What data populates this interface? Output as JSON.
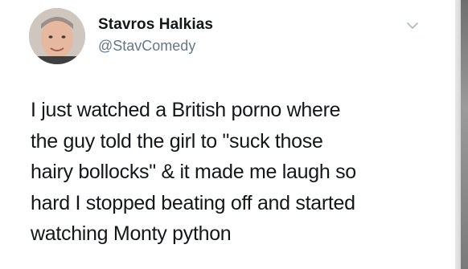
{
  "tweet": {
    "display_name": "Stavros Halkias",
    "handle": "@StavComedy",
    "text_lines": [
      "I just watched a British porno where",
      "the guy told the girl to \"suck those",
      "hairy bollocks\" & it made me laugh so",
      "hard I stopped beating off and started",
      "watching Monty python"
    ]
  },
  "icons": {
    "avatar": "profile-photo",
    "menu": "chevron-down-icon"
  },
  "colors": {
    "name": "#14171a",
    "handle": "#657786",
    "chevron": "#aab8c2"
  }
}
